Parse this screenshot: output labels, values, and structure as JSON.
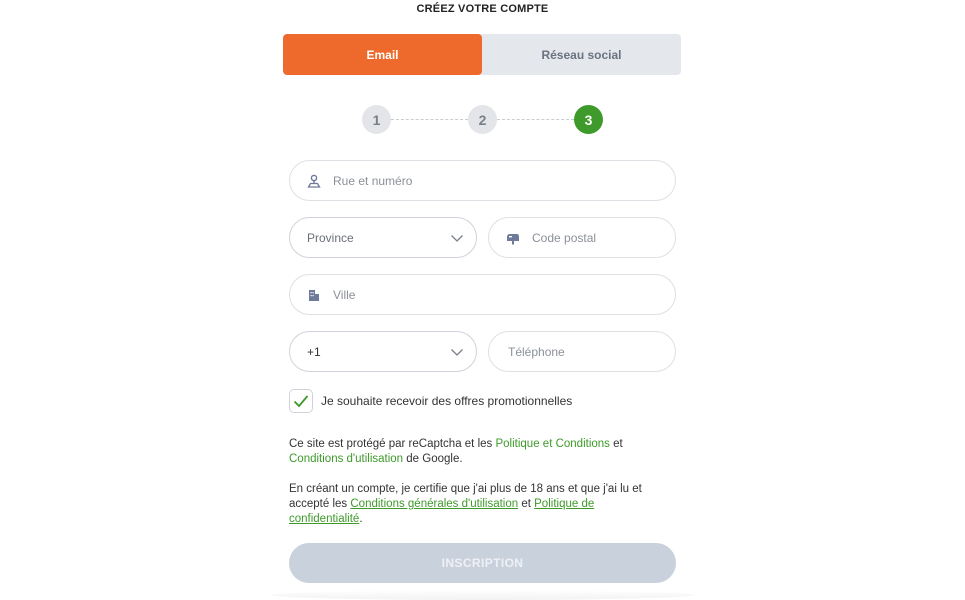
{
  "header": {
    "title": "CRÉEZ VOTRE COMPTE"
  },
  "tabs": [
    {
      "label": "Email",
      "active": true
    },
    {
      "label": "Réseau social",
      "active": false
    }
  ],
  "steps": [
    "1",
    "2",
    "3"
  ],
  "current_step": 3,
  "form": {
    "street": {
      "placeholder": "Rue et numéro",
      "icon": "map-marker-icon"
    },
    "province": {
      "value": "Province"
    },
    "postal": {
      "placeholder": "Code postal",
      "icon": "mailbox-icon"
    },
    "city": {
      "placeholder": "Ville",
      "icon": "building-icon"
    },
    "phone_code": {
      "value": "+1"
    },
    "phone": {
      "placeholder": "Téléphone"
    }
  },
  "promo": {
    "label": "Je souhaite recevoir des offres promotionnelles",
    "checked": true
  },
  "recaptcha": {
    "part1": "Ce site est protégé par reCaptcha et les ",
    "link1": "Politique et Conditions",
    "part2": " et ",
    "link2": "Conditions d'utilisation",
    "part3": " de Google."
  },
  "terms": {
    "part1": "En créant un compte, je certifie que j'ai plus de 18 ans et que j'ai lu et accepté les ",
    "link1": "Conditions générales d'utilisation",
    "part2": " et ",
    "link2": "Politique de confidentialité",
    "part3": "."
  },
  "submit_label": "INSCRIPTION",
  "colors": {
    "accent": "#ee6a2c",
    "success": "#3e9a2a",
    "disabled_button": "#c9d1dd"
  }
}
